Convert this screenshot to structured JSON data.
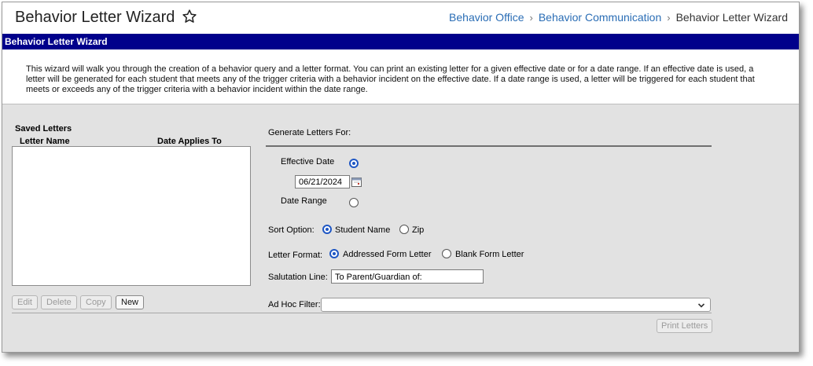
{
  "header": {
    "title": "Behavior Letter Wizard",
    "star_icon": "star-outline-icon",
    "breadcrumbs": [
      {
        "label": "Behavior Office"
      },
      {
        "label": "Behavior Communication"
      },
      {
        "label": "Behavior Letter Wizard"
      }
    ]
  },
  "section_bar": {
    "title": "Behavior Letter Wizard",
    "color": "#00008b"
  },
  "intro": {
    "text": "This wizard will walk you through the creation of a behavior query and a letter format. You can print an existing letter for a given effective date or for a date range. If an effective date is used, a letter will be generated for each student that meets any of the trigger criteria with a behavior incident on the effective date. If a date range is used, a letter will be triggered for each student that meets or exceeds any of the trigger criteria with a behavior incident within the date range."
  },
  "saved_letters": {
    "title": "Saved Letters",
    "columns": [
      "Letter Name",
      "Date Applies To"
    ],
    "buttons": {
      "edit": "Edit",
      "delete": "Delete",
      "copy": "Copy",
      "new": "New"
    }
  },
  "generate": {
    "title": "Generate Letters For:",
    "effective_date_label": "Effective Date",
    "effective_date_value": "06/21/2024",
    "date_range_label": "Date Range",
    "sort_option_label": "Sort Option:",
    "sort_options": [
      "Student Name",
      "Zip"
    ],
    "letter_format_label": "Letter Format:",
    "letter_formats": [
      "Addressed Form Letter",
      "Blank Form Letter"
    ],
    "salutation_label": "Salutation Line:",
    "salutation_value": "To Parent/Guardian of:",
    "adhoc_label": "Ad Hoc Filter:",
    "adhoc_value": "",
    "print_button": "Print Letters"
  },
  "colors": {
    "link": "#2a6db5",
    "radio_selected": "#1f57c4",
    "panel_bg": "#e2e2e2"
  }
}
